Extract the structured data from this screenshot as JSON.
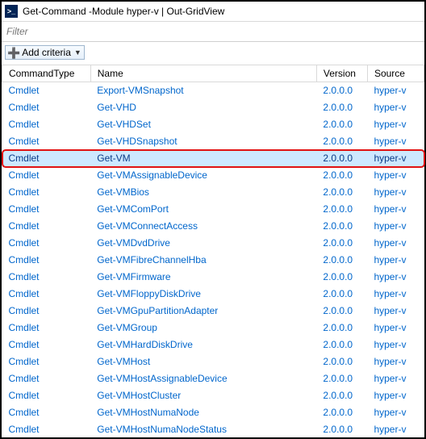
{
  "window": {
    "title": "Get-Command -Module hyper-v | Out-GridView"
  },
  "filter": {
    "placeholder": "Filter"
  },
  "toolbar": {
    "add_criteria_label": "Add criteria"
  },
  "columns": {
    "command_type": "CommandType",
    "name": "Name",
    "version": "Version",
    "source": "Source"
  },
  "rows": [
    {
      "type": "Cmdlet",
      "name": "Export-VMSnapshot",
      "version": "2.0.0.0",
      "source": "hyper-v",
      "highlight": false
    },
    {
      "type": "Cmdlet",
      "name": "Get-VHD",
      "version": "2.0.0.0",
      "source": "hyper-v",
      "highlight": false
    },
    {
      "type": "Cmdlet",
      "name": "Get-VHDSet",
      "version": "2.0.0.0",
      "source": "hyper-v",
      "highlight": false
    },
    {
      "type": "Cmdlet",
      "name": "Get-VHDSnapshot",
      "version": "2.0.0.0",
      "source": "hyper-v",
      "highlight": false
    },
    {
      "type": "Cmdlet",
      "name": "Get-VM",
      "version": "2.0.0.0",
      "source": "hyper-v",
      "highlight": true
    },
    {
      "type": "Cmdlet",
      "name": "Get-VMAssignableDevice",
      "version": "2.0.0.0",
      "source": "hyper-v",
      "highlight": false
    },
    {
      "type": "Cmdlet",
      "name": "Get-VMBios",
      "version": "2.0.0.0",
      "source": "hyper-v",
      "highlight": false
    },
    {
      "type": "Cmdlet",
      "name": "Get-VMComPort",
      "version": "2.0.0.0",
      "source": "hyper-v",
      "highlight": false
    },
    {
      "type": "Cmdlet",
      "name": "Get-VMConnectAccess",
      "version": "2.0.0.0",
      "source": "hyper-v",
      "highlight": false
    },
    {
      "type": "Cmdlet",
      "name": "Get-VMDvdDrive",
      "version": "2.0.0.0",
      "source": "hyper-v",
      "highlight": false
    },
    {
      "type": "Cmdlet",
      "name": "Get-VMFibreChannelHba",
      "version": "2.0.0.0",
      "source": "hyper-v",
      "highlight": false
    },
    {
      "type": "Cmdlet",
      "name": "Get-VMFirmware",
      "version": "2.0.0.0",
      "source": "hyper-v",
      "highlight": false
    },
    {
      "type": "Cmdlet",
      "name": "Get-VMFloppyDiskDrive",
      "version": "2.0.0.0",
      "source": "hyper-v",
      "highlight": false
    },
    {
      "type": "Cmdlet",
      "name": "Get-VMGpuPartitionAdapter",
      "version": "2.0.0.0",
      "source": "hyper-v",
      "highlight": false
    },
    {
      "type": "Cmdlet",
      "name": "Get-VMGroup",
      "version": "2.0.0.0",
      "source": "hyper-v",
      "highlight": false
    },
    {
      "type": "Cmdlet",
      "name": "Get-VMHardDiskDrive",
      "version": "2.0.0.0",
      "source": "hyper-v",
      "highlight": false
    },
    {
      "type": "Cmdlet",
      "name": "Get-VMHost",
      "version": "2.0.0.0",
      "source": "hyper-v",
      "highlight": false
    },
    {
      "type": "Cmdlet",
      "name": "Get-VMHostAssignableDevice",
      "version": "2.0.0.0",
      "source": "hyper-v",
      "highlight": false
    },
    {
      "type": "Cmdlet",
      "name": "Get-VMHostCluster",
      "version": "2.0.0.0",
      "source": "hyper-v",
      "highlight": false
    },
    {
      "type": "Cmdlet",
      "name": "Get-VMHostNumaNode",
      "version": "2.0.0.0",
      "source": "hyper-v",
      "highlight": false
    },
    {
      "type": "Cmdlet",
      "name": "Get-VMHostNumaNodeStatus",
      "version": "2.0.0.0",
      "source": "hyper-v",
      "highlight": false
    }
  ]
}
